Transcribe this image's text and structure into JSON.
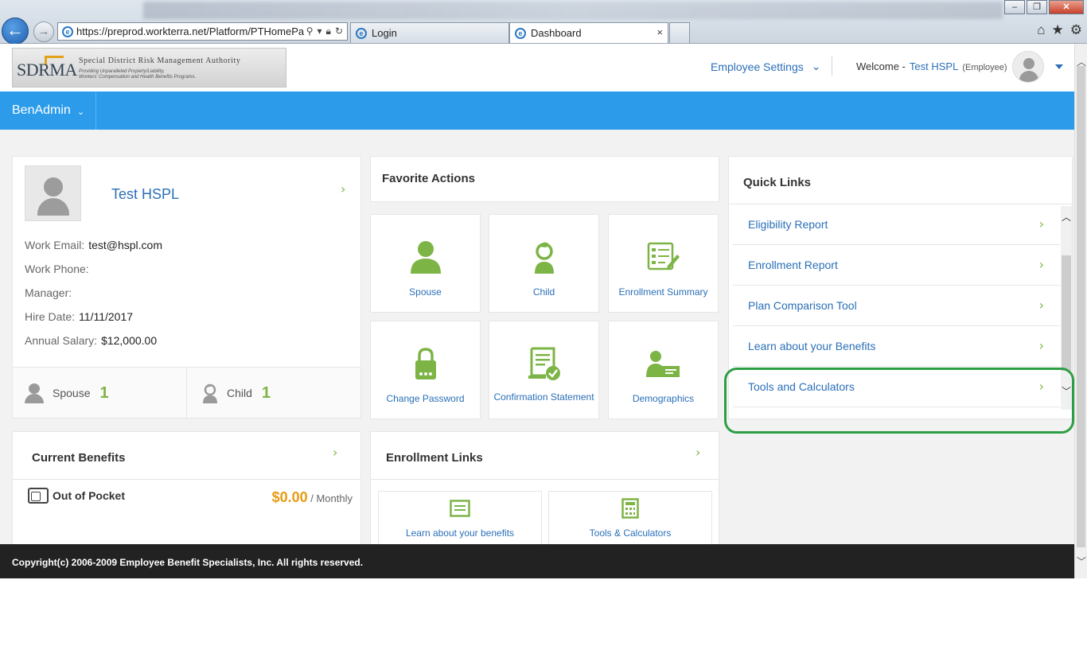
{
  "browser": {
    "url": "https://preprod.workterra.net/Platform/PTHomePa",
    "tabs": [
      {
        "label": "Login"
      },
      {
        "label": "Dashboard"
      }
    ],
    "close_glyph": "×"
  },
  "header": {
    "logo": {
      "mark": "SDRMA",
      "org": "Special District Risk Management Authority",
      "tagline1": "Providing Unparalleled Property/Liability,",
      "tagline2": "Workers' Compensation and Health Benefits Programs."
    },
    "employee_settings": "Employee Settings",
    "welcome_label": "Welcome -",
    "user_name": "Test HSPL",
    "user_role": "(Employee)"
  },
  "nav": {
    "menu_label": "BenAdmin"
  },
  "profile": {
    "name": "Test HSPL",
    "fields": [
      {
        "label": "Work Email:",
        "value": "test@hspl.com"
      },
      {
        "label": "Work Phone:",
        "value": ""
      },
      {
        "label": "Manager:",
        "value": ""
      },
      {
        "label": "Hire Date:",
        "value": "11/11/2017"
      },
      {
        "label": "Annual Salary:",
        "value": "$12,000.00"
      }
    ],
    "spouse": {
      "label": "Spouse",
      "count": "1"
    },
    "child": {
      "label": "Child",
      "count": "1"
    }
  },
  "favorite_actions": {
    "title": "Favorite Actions",
    "tiles": [
      {
        "label": "Spouse",
        "icon": "person-icon"
      },
      {
        "label": "Child",
        "icon": "child-icon"
      },
      {
        "label": "Enrollment Summary",
        "icon": "checklist-icon"
      },
      {
        "label": "Change Password",
        "icon": "lock-icon"
      },
      {
        "label": "Confirmation Statement",
        "icon": "document-check-icon"
      },
      {
        "label": "Demographics",
        "icon": "id-card-icon"
      }
    ]
  },
  "quick_links": {
    "title": "Quick Links",
    "items": [
      {
        "label": "Eligibility Report"
      },
      {
        "label": "Enrollment Report"
      },
      {
        "label": "Plan Comparison Tool"
      },
      {
        "label": "Learn about your Benefits"
      },
      {
        "label": "Tools and Calculators"
      }
    ]
  },
  "current_benefits": {
    "title": "Current Benefits",
    "item_label": "Out of Pocket",
    "amount": "$0.00",
    "period": "/ Monthly"
  },
  "enrollment_links": {
    "title": "Enrollment Links",
    "links": [
      {
        "label": "Learn about your benefits",
        "icon": "document-lines-icon"
      },
      {
        "label": "Tools & Calculators",
        "icon": "calculator-icon"
      }
    ]
  },
  "footer": {
    "text": "Copyright(c) 2006-2009 Employee Benefit Specialists, Inc. All rights reserved."
  },
  "colors": {
    "nav_blue": "#2b9bea",
    "link_blue": "#2a6fb8",
    "icon_green": "#7db446",
    "amount_orange": "#e89b13",
    "highlight_circle": "#2e9e45",
    "footer_bg": "#222222"
  }
}
